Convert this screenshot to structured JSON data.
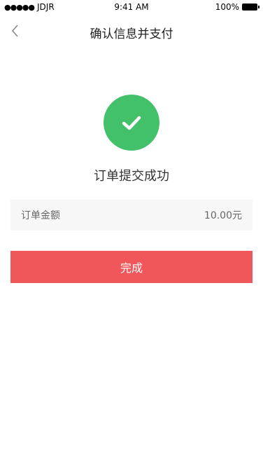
{
  "status_bar": {
    "carrier": "JDJR",
    "time": "9:41 AM",
    "battery": "100%"
  },
  "nav": {
    "title": "确认信息并支付"
  },
  "success": {
    "message": "订单提交成功",
    "icon": "check-icon",
    "icon_color": "#43c06a"
  },
  "order": {
    "amount_label": "订单金额",
    "amount_value": "10.00元"
  },
  "actions": {
    "done_label": "完成",
    "done_color": "#f0575a"
  }
}
